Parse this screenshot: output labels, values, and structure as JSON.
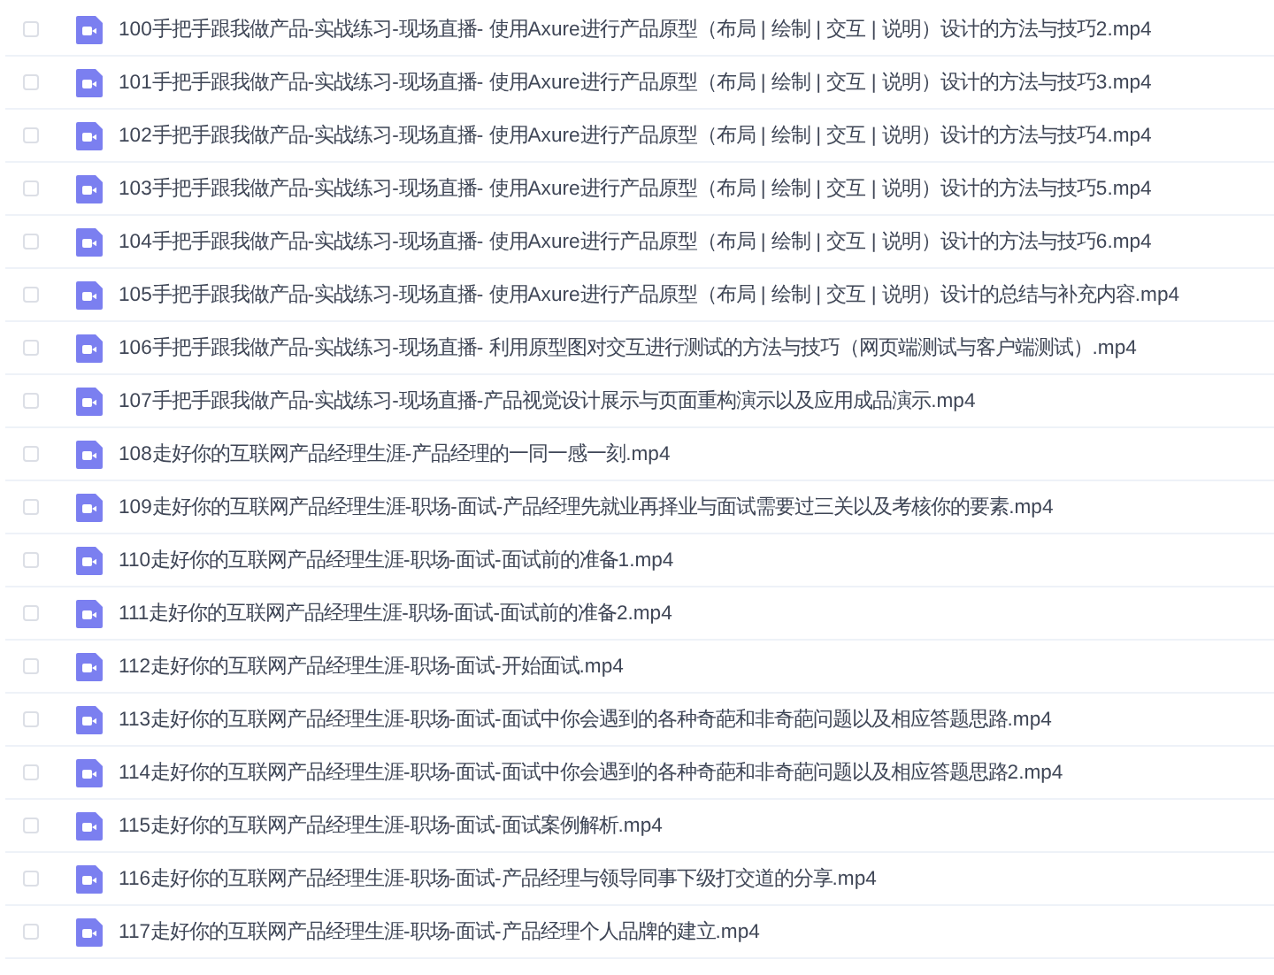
{
  "files": [
    {
      "name": "100手把手跟我做产品-实战练习-现场直播- 使用Axure进行产品原型（布局 | 绘制 | 交互 | 说明）设计的方法与技巧2.mp4",
      "checked": false
    },
    {
      "name": "101手把手跟我做产品-实战练习-现场直播- 使用Axure进行产品原型（布局 | 绘制 | 交互 | 说明）设计的方法与技巧3.mp4",
      "checked": false
    },
    {
      "name": "102手把手跟我做产品-实战练习-现场直播- 使用Axure进行产品原型（布局 | 绘制 | 交互 | 说明）设计的方法与技巧4.mp4",
      "checked": false
    },
    {
      "name": "103手把手跟我做产品-实战练习-现场直播- 使用Axure进行产品原型（布局 | 绘制 | 交互 | 说明）设计的方法与技巧5.mp4",
      "checked": false
    },
    {
      "name": "104手把手跟我做产品-实战练习-现场直播- 使用Axure进行产品原型（布局 | 绘制 | 交互 | 说明）设计的方法与技巧6.mp4",
      "checked": false
    },
    {
      "name": "105手把手跟我做产品-实战练习-现场直播- 使用Axure进行产品原型（布局 | 绘制 | 交互 | 说明）设计的总结与补充内容.mp4",
      "checked": false
    },
    {
      "name": "106手把手跟我做产品-实战练习-现场直播- 利用原型图对交互进行测试的方法与技巧（网页端测试与客户端测试）.mp4",
      "checked": false
    },
    {
      "name": "107手把手跟我做产品-实战练习-现场直播-产品视觉设计展示与页面重构演示以及应用成品演示.mp4",
      "checked": false
    },
    {
      "name": "108走好你的互联网产品经理生涯-产品经理的一同一感一刻.mp4",
      "checked": false
    },
    {
      "name": "109走好你的互联网产品经理生涯-职场-面试-产品经理先就业再择业与面试需要过三关以及考核你的要素.mp4",
      "checked": false
    },
    {
      "name": "110走好你的互联网产品经理生涯-职场-面试-面试前的准备1.mp4",
      "checked": false
    },
    {
      "name": "111走好你的互联网产品经理生涯-职场-面试-面试前的准备2.mp4",
      "checked": false
    },
    {
      "name": "112走好你的互联网产品经理生涯-职场-面试-开始面试.mp4",
      "checked": false
    },
    {
      "name": "113走好你的互联网产品经理生涯-职场-面试-面试中你会遇到的各种奇葩和非奇葩问题以及相应答题思路.mp4",
      "checked": false
    },
    {
      "name": "114走好你的互联网产品经理生涯-职场-面试-面试中你会遇到的各种奇葩和非奇葩问题以及相应答题思路2.mp4",
      "checked": false
    },
    {
      "name": "115走好你的互联网产品经理生涯-职场-面试-面试案例解析.mp4",
      "checked": false
    },
    {
      "name": "116走好你的互联网产品经理生涯-职场-面试-产品经理与领导同事下级打交道的分享.mp4",
      "checked": false
    },
    {
      "name": "117走好你的互联网产品经理生涯-职场-面试-产品经理个人品牌的建立.mp4",
      "checked": false
    }
  ]
}
